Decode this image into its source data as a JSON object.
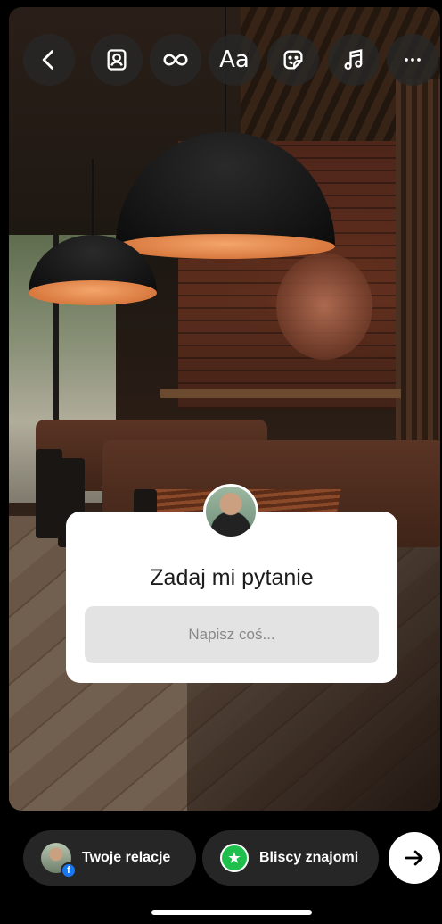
{
  "toolbar": {
    "buttons": [
      {
        "icon": "chevron-left-icon"
      },
      {
        "icon": "portrait-icon"
      },
      {
        "icon": "infinity-icon"
      },
      {
        "icon": "text-icon",
        "label": "Aa"
      },
      {
        "icon": "sticker-icon"
      },
      {
        "icon": "music-icon"
      },
      {
        "icon": "more-icon"
      }
    ]
  },
  "question_sticker": {
    "title": "Zadaj mi pytanie",
    "placeholder": "Napisz coś..."
  },
  "share_bar": {
    "your_story_label": "Twoje relacje",
    "close_friends_label": "Bliscy znajomi",
    "facebook_badge": "f",
    "close_friends_badge": "★",
    "close_friends_color": "#1fbf4d",
    "facebook_color": "#1877f2"
  }
}
